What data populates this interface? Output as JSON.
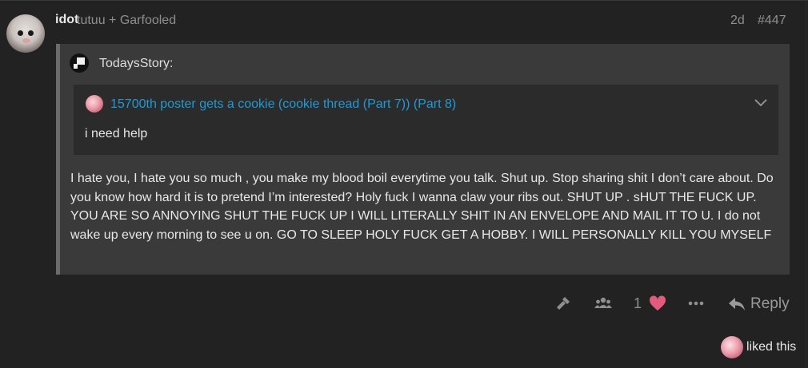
{
  "post": {
    "username": "idot",
    "user_title": "tutuu + Garfooled",
    "date": "2d",
    "post_number": "#447",
    "quote": {
      "author": "TodaysStory:",
      "inner_quote": {
        "topic_title": "15700th poster gets a cookie (cookie thread (Part 7)) (Part 8)",
        "text": "i need help"
      },
      "body": "I hate you, I hate you so much , you make my blood boil everytime you talk. Shut up. Stop sharing shit I don’t care about. Do you know how hard it is to pretend I’m interested? Holy fuck I wanna claw your ribs out. SHUT UP . sHUT THE FUCK UP. YOU ARE SO ANNOYING SHUT THE FUCK UP I WILL LITERALLY SHIT IN AN ENVELOPE AND MAIL IT TO U. I do not wake up every morning to see u on. GO TO SLEEP HOLY FUCK GET A HOBBY. I WILL PERSONALLY KILL YOU MYSELF"
    },
    "actions": {
      "like_count": "1",
      "reply_label": "Reply",
      "icons": [
        "hammer-icon",
        "users-icon",
        "heart-icon",
        "ellipsis-icon",
        "reply-icon"
      ]
    },
    "liked_by": {
      "text": "liked this"
    }
  },
  "colors": {
    "background": "#222222",
    "quote_background": "#3a3a3a",
    "inner_quote_background": "#2b2b2b",
    "link": "#1f9ad6",
    "heart": "#e45a7d",
    "muted": "#8f8f8f"
  }
}
